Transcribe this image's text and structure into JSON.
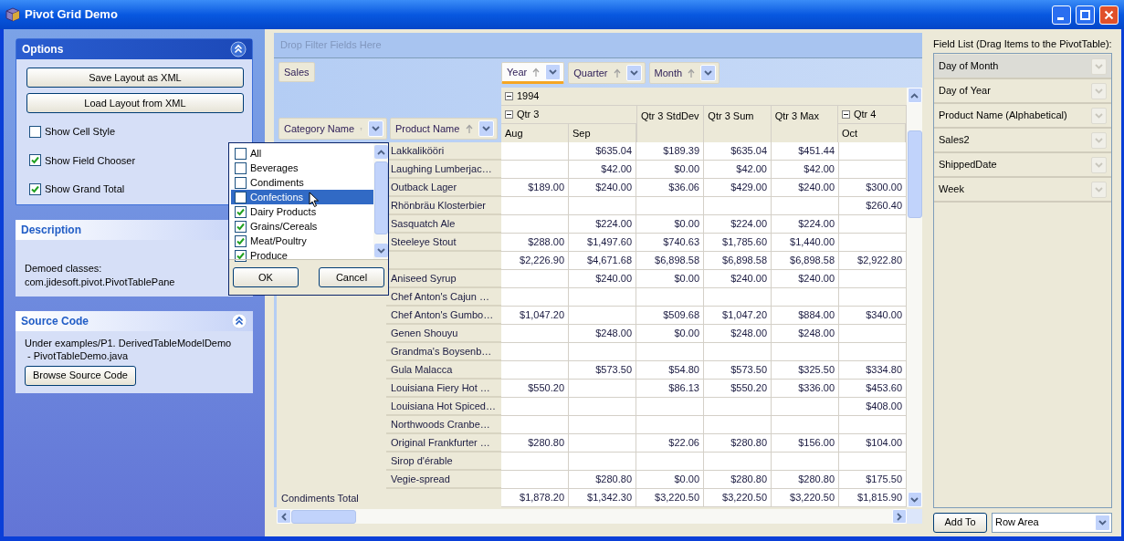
{
  "window": {
    "title": "Pivot Grid Demo"
  },
  "options": {
    "title": "Options",
    "expanded": true,
    "buttons": [
      "Save Layout as XML",
      "Load Layout from XML"
    ],
    "checkboxes": [
      {
        "label": "Show Cell Style",
        "checked": false
      },
      {
        "label": "Show Field Chooser",
        "checked": true
      },
      {
        "label": "Show Grand Total",
        "checked": true
      }
    ]
  },
  "description": {
    "title": "Description",
    "lines": [
      "Demoed classes:",
      "com.jidesoft.pivot.PivotTablePane"
    ]
  },
  "source_code": {
    "title": "Source Code",
    "expanded": true,
    "lines": [
      "Under examples/P1. DerivedTableModelDemo",
      " - PivotTableDemo.java"
    ],
    "button": "Browse Source Code"
  },
  "pivot": {
    "filter_placeholder": "Drop Filter Fields Here",
    "data_fields": [
      "Sales"
    ],
    "column_fields": [
      {
        "label": "Year",
        "selected": true
      },
      {
        "label": "Quarter",
        "selected": false
      },
      {
        "label": "Month",
        "selected": false
      }
    ],
    "row_fields": [
      {
        "label": "Category Name"
      },
      {
        "label": "Product Name"
      }
    ],
    "year": {
      "label": "1994",
      "expanded": true
    },
    "column_groups": [
      {
        "kind": "group",
        "label": "Qtr 3",
        "expanded": true,
        "months": [
          "Aug",
          "Sep"
        ]
      },
      {
        "kind": "total",
        "label": "Qtr 3 StdDev"
      },
      {
        "kind": "total",
        "label": "Qtr 3 Sum"
      },
      {
        "kind": "total",
        "label": "Qtr 3 Max"
      },
      {
        "kind": "group",
        "label": "Qtr 4",
        "expanded": true,
        "months": [
          "Oct"
        ]
      }
    ],
    "rows": [
      {
        "kind": "item",
        "product": "Lakkalikööri",
        "cells": {
          "column_2": "$635.04",
          "column_3": "$189.39",
          "column_4": "$635.04",
          "column_5": "$451.44"
        }
      },
      {
        "kind": "item",
        "product": "Laughing Lumberjac…",
        "cells": {
          "column_2": "$42.00",
          "column_3": "$0.00",
          "column_4": "$42.00",
          "column_5": "$42.00"
        }
      },
      {
        "kind": "item",
        "product": "Outback Lager",
        "cells": {
          "column_1": "$189.00",
          "column_2": "$240.00",
          "column_3": "$36.06",
          "column_4": "$429.00",
          "column_5": "$240.00",
          "column_6": "$300.00"
        }
      },
      {
        "kind": "item",
        "product": "Rhönbräu Klosterbier",
        "cells": {
          "column_6": "$260.40"
        }
      },
      {
        "kind": "item",
        "product": "Sasquatch Ale",
        "cells": {
          "column_2": "$224.00",
          "column_3": "$0.00",
          "column_4": "$224.00",
          "column_5": "$224.00"
        }
      },
      {
        "kind": "item",
        "product": "Steeleye Stout",
        "cells": {
          "column_1": "$288.00",
          "column_2": "$1,497.60",
          "column_3": "$740.63",
          "column_4": "$1,785.60",
          "column_5": "$1,440.00"
        }
      },
      {
        "kind": "subtotal",
        "cells": {
          "column_1": "$2,226.90",
          "column_2": "$4,671.68",
          "column_3": "$6,898.58",
          "column_4": "$6,898.58",
          "column_5": "$6,898.58",
          "column_6": "$2,922.80"
        }
      },
      {
        "kind": "item",
        "product": "Aniseed Syrup",
        "cells": {
          "column_2": "$240.00",
          "column_3": "$0.00",
          "column_4": "$240.00",
          "column_5": "$240.00"
        }
      },
      {
        "kind": "item",
        "product": "Chef Anton's Cajun …",
        "cells": {}
      },
      {
        "kind": "item",
        "product": "Chef Anton's Gumbo…",
        "cells": {
          "column_1": "$1,047.20",
          "column_3": "$509.68",
          "column_4": "$1,047.20",
          "column_5": "$884.00",
          "column_6": "$340.00"
        }
      },
      {
        "kind": "item",
        "product": "Genen Shouyu",
        "cells": {
          "column_2": "$248.00",
          "column_3": "$0.00",
          "column_4": "$248.00",
          "column_5": "$248.00"
        }
      },
      {
        "kind": "item",
        "product": "Grandma's Boysenb…",
        "cells": {}
      },
      {
        "kind": "item",
        "product": "Gula Malacca",
        "cells": {
          "column_2": "$573.50",
          "column_3": "$54.80",
          "column_4": "$573.50",
          "column_5": "$325.50",
          "column_6": "$334.80"
        }
      },
      {
        "kind": "item",
        "product": "Louisiana Fiery Hot …",
        "cells": {
          "column_1": "$550.20",
          "column_3": "$86.13",
          "column_4": "$550.20",
          "column_5": "$336.00",
          "column_6": "$453.60"
        }
      },
      {
        "kind": "item",
        "product": "Louisiana Hot Spiced…",
        "cells": {
          "column_6": "$408.00"
        }
      },
      {
        "kind": "item",
        "product": "Northwoods Cranbe…",
        "cells": {}
      },
      {
        "kind": "item",
        "product": "Original Frankfurter …",
        "cells": {
          "column_1": "$280.80",
          "column_3": "$22.06",
          "column_4": "$280.80",
          "column_5": "$156.00",
          "column_6": "$104.00"
        }
      },
      {
        "kind": "item",
        "product": "Sirop d'érable",
        "cells": {}
      },
      {
        "kind": "item",
        "product": "Vegie-spread",
        "cells": {
          "column_2": "$280.80",
          "column_3": "$0.00",
          "column_4": "$280.80",
          "column_5": "$280.80",
          "column_6": "$175.50"
        }
      }
    ],
    "total": {
      "label": "Condiments Total",
      "cells": {
        "column_1": "$1,878.20",
        "column_2": "$1,342.30",
        "column_3": "$3,220.50",
        "column_4": "$3,220.50",
        "column_5": "$3,220.50",
        "column_6": "$1,815.90"
      }
    }
  },
  "filter_popup": {
    "items": [
      {
        "label": "All",
        "checked": false,
        "selected": false
      },
      {
        "label": "Beverages",
        "checked": false,
        "selected": false
      },
      {
        "label": "Condiments",
        "checked": false,
        "selected": false
      },
      {
        "label": "Confections",
        "checked": false,
        "selected": true
      },
      {
        "label": "Dairy Products",
        "checked": true,
        "selected": false
      },
      {
        "label": "Grains/Cereals",
        "checked": true,
        "selected": false
      },
      {
        "label": "Meat/Poultry",
        "checked": true,
        "selected": false
      },
      {
        "label": "Produce",
        "checked": true,
        "selected": false
      }
    ],
    "buttons": [
      "OK",
      "Cancel"
    ]
  },
  "field_list": {
    "title": "Field List (Drag Items to the PivotTable):",
    "items": [
      {
        "label": "Day of Month",
        "selected": true
      },
      {
        "label": "Day of Year",
        "selected": false
      },
      {
        "label": "Product Name (Alphabetical)",
        "selected": false
      },
      {
        "label": "Sales2",
        "selected": false
      },
      {
        "label": "ShippedDate",
        "selected": false
      },
      {
        "label": "Week",
        "selected": false
      }
    ],
    "add_button": "Add To",
    "area_select": "Row Area"
  }
}
